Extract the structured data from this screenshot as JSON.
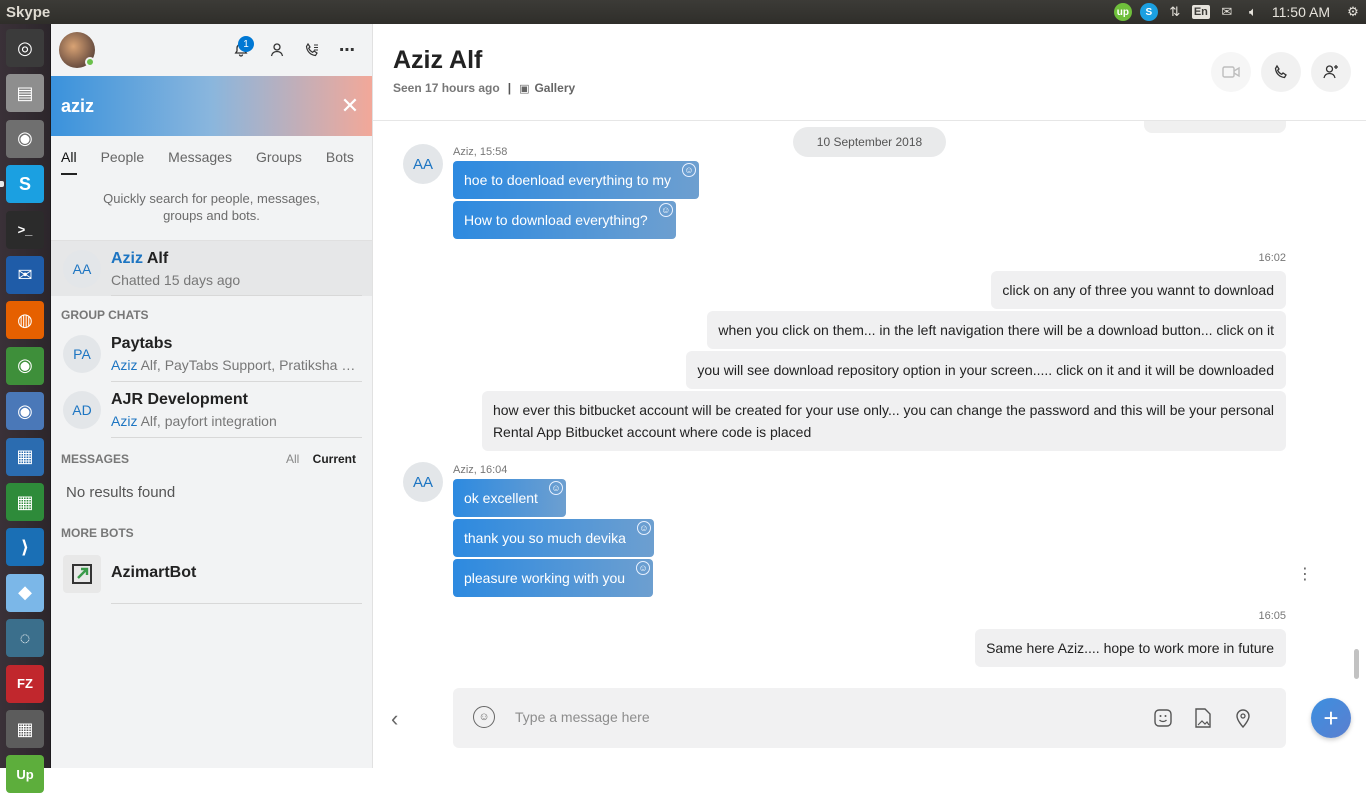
{
  "system_bar": {
    "app_title": "Skype",
    "tray": {
      "upwork_icon": "upwork-icon",
      "skype_icon": "skype-icon",
      "network_icon": "network-icon",
      "keyboard_layout": "En",
      "mail_icon": "mail-icon",
      "volume_icon": "volume-icon",
      "clock": "11:50 AM",
      "settings_icon": "gear-icon"
    }
  },
  "launcher": {
    "items": [
      {
        "name": "ubuntu-dash-icon",
        "glyph": "◎",
        "bg": "#3b3b3b"
      },
      {
        "name": "files-icon",
        "glyph": "▤",
        "bg": "#8e8e8e"
      },
      {
        "name": "camera-icon",
        "glyph": "◉",
        "bg": "#6f6f6f"
      },
      {
        "name": "skype-icon",
        "glyph": "S",
        "bg": "#1ba0e1"
      },
      {
        "name": "terminal-icon",
        "glyph": ">_",
        "bg": "#2b2b2b"
      },
      {
        "name": "thunderbird-icon",
        "glyph": "✉",
        "bg": "#1f5ca8"
      },
      {
        "name": "firefox-icon",
        "glyph": "◍",
        "bg": "#e66000"
      },
      {
        "name": "chrome-icon",
        "glyph": "◉",
        "bg": "#3e8f3a"
      },
      {
        "name": "chromium-icon",
        "glyph": "◉",
        "bg": "#4a78b8"
      },
      {
        "name": "writer-icon",
        "glyph": "▦",
        "bg": "#2b6cb0"
      },
      {
        "name": "calc-icon",
        "glyph": "▦",
        "bg": "#2e8b3a"
      },
      {
        "name": "vscode-icon",
        "glyph": "⟩",
        "bg": "#1a6fb5"
      },
      {
        "name": "box-icon",
        "glyph": "◆",
        "bg": "#7bb7e8"
      },
      {
        "name": "mysql-workbench-icon",
        "glyph": "◌",
        "bg": "#3b6f8c"
      },
      {
        "name": "filezilla-icon",
        "glyph": "FZ",
        "bg": "#c1272d"
      },
      {
        "name": "calculator-icon",
        "glyph": "▦",
        "bg": "#5c5c5c"
      },
      {
        "name": "upwork-launcher-icon",
        "glyph": "Up",
        "bg": "#5dae3c"
      }
    ]
  },
  "sidebar": {
    "notifications_count": "1",
    "search": {
      "value": "aziz",
      "placeholder": "Search"
    },
    "tabs": [
      {
        "label": "All",
        "active": true
      },
      {
        "label": "People",
        "active": false
      },
      {
        "label": "Messages",
        "active": false
      },
      {
        "label": "Groups",
        "active": false
      },
      {
        "label": "Bots",
        "active": false
      }
    ],
    "hint_line1": "Quickly search for people, messages,",
    "hint_line2": "groups and bots.",
    "top_contact": {
      "initials": "AA",
      "name_highlight": "Aziz",
      "name_rest": " Alf",
      "subtitle": "Chatted 15 days ago"
    },
    "group_chats_title": "GROUP CHATS",
    "groups": [
      {
        "initials": "PA",
        "name": "Paytabs",
        "sub_highlight": "Aziz",
        "sub_rest": " Alf, PayTabs Support, Pratiksha R..."
      },
      {
        "initials": "AD",
        "name": "AJR Development",
        "sub_highlight": "Aziz",
        "sub_rest": " Alf, payfort integration"
      }
    ],
    "messages_title": "MESSAGES",
    "messages_filter_all": "All",
    "messages_filter_current": "Current",
    "no_results": "No results found",
    "more_bots_title": "MORE BOTS",
    "bot": {
      "name": "AzimartBot"
    }
  },
  "chat": {
    "title": "Aziz Alf",
    "status": "Seen 17 hours ago",
    "separator": "|",
    "gallery": "Gallery",
    "date_pill": "10 September 2018",
    "incoming_avatar": "AA",
    "group1_meta": "Aziz, 15:58",
    "group1": [
      "hoe to doenload everything to my",
      "How to download everything?"
    ],
    "time_out1": "16:02",
    "outgoing1": [
      "click on any of three you wannt to download",
      "when you click on them... in the left navigation there will be a download button... click on it",
      "you will see download repository option in your screen..... click on it and it will be downloaded"
    ],
    "outgoing1_long_line1": "how ever this bitbucket account will be created for your use only... you can change the password and this will be your personal",
    "outgoing1_long_line2": "Rental App Bitbucket account where code is placed",
    "group2_meta": "Aziz, 16:04",
    "group2": [
      "ok excellent",
      "thank you so much devika",
      "pleasure working with you"
    ],
    "time_out2": "16:05",
    "outgoing2": "Same here Aziz.... hope to work more in future",
    "composer_placeholder": "Type a message here"
  }
}
